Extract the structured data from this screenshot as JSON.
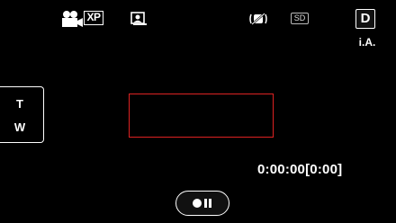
{
  "status_bar": {
    "mode_icon": "video-camera-icon",
    "quality": "XP",
    "user_icon": "user-button-icon",
    "stabilizer_icon": "image-stabilizer-icon",
    "media": "SD",
    "mode_button": "D",
    "intelligent_auto": "i.A."
  },
  "zoom": {
    "tele_label": "T",
    "wide_label": "W"
  },
  "counter": {
    "time": "0:00:00[0:00]"
  },
  "controls": {
    "record_icon": "record-pause-icon"
  },
  "colors": {
    "background": "#000000",
    "focus_frame": "#dd2222",
    "text": "#ffffff"
  }
}
